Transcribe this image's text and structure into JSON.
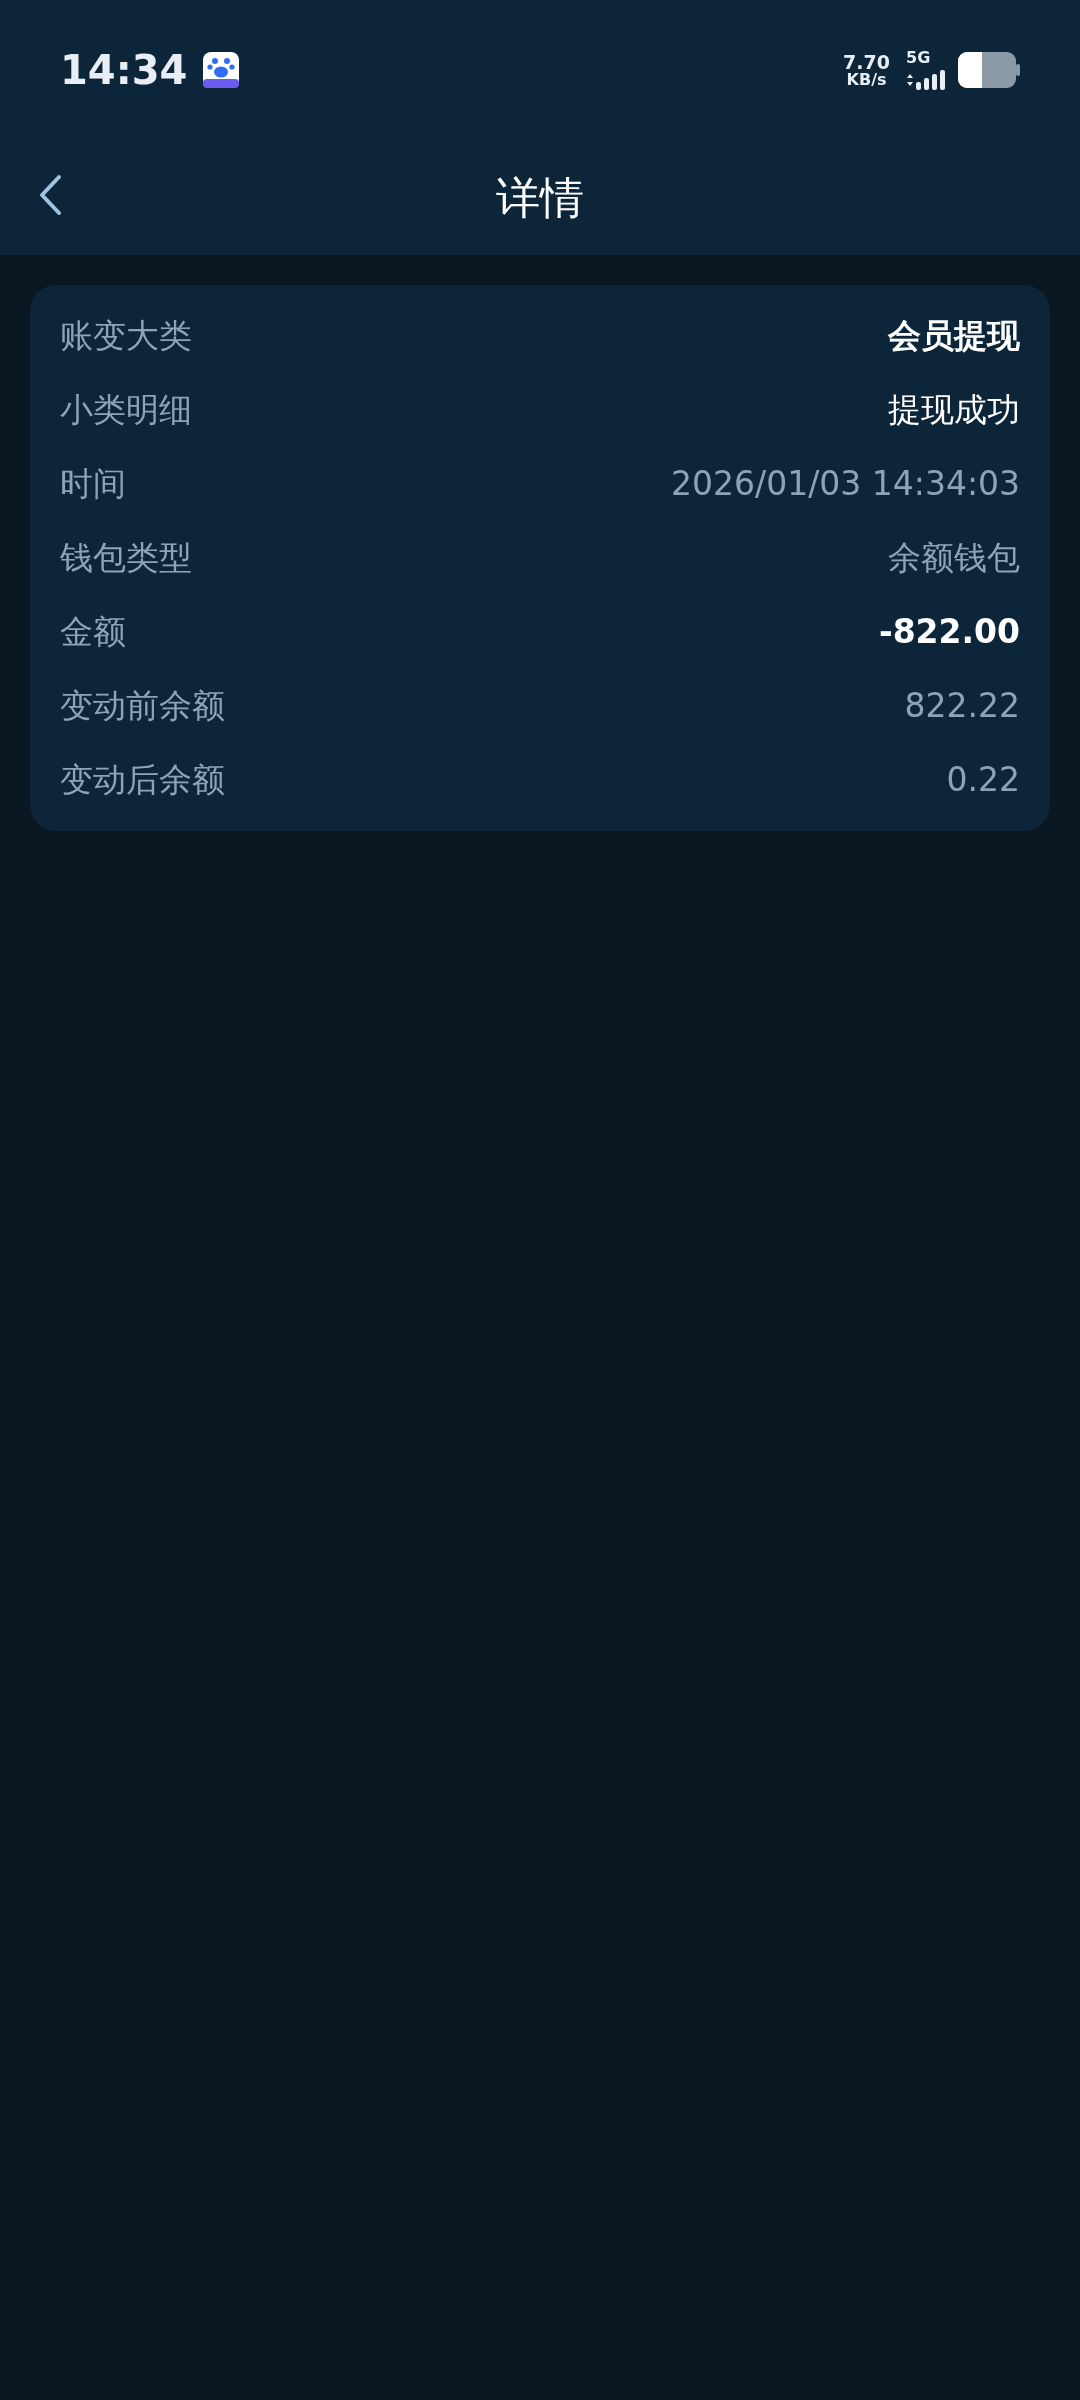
{
  "status_bar": {
    "time": "14:34",
    "speed_value": "7.70",
    "speed_unit": "KB/s",
    "network": "5G"
  },
  "header": {
    "title": "详情"
  },
  "details": [
    {
      "label": "账变大类",
      "value": "会员提现",
      "kind": "bold"
    },
    {
      "label": "小类明细",
      "value": "提现成功",
      "kind": "bright"
    },
    {
      "label": "时间",
      "value": "2026/01/03 14:34:03",
      "kind": "muted"
    },
    {
      "label": "钱包类型",
      "value": "余额钱包",
      "kind": "muted"
    },
    {
      "label": "金额",
      "value": "-822.00",
      "kind": "bold"
    },
    {
      "label": "变动前余额",
      "value": "822.22",
      "kind": "muted"
    },
    {
      "label": "变动后余额",
      "value": "0.22",
      "kind": "muted"
    }
  ]
}
